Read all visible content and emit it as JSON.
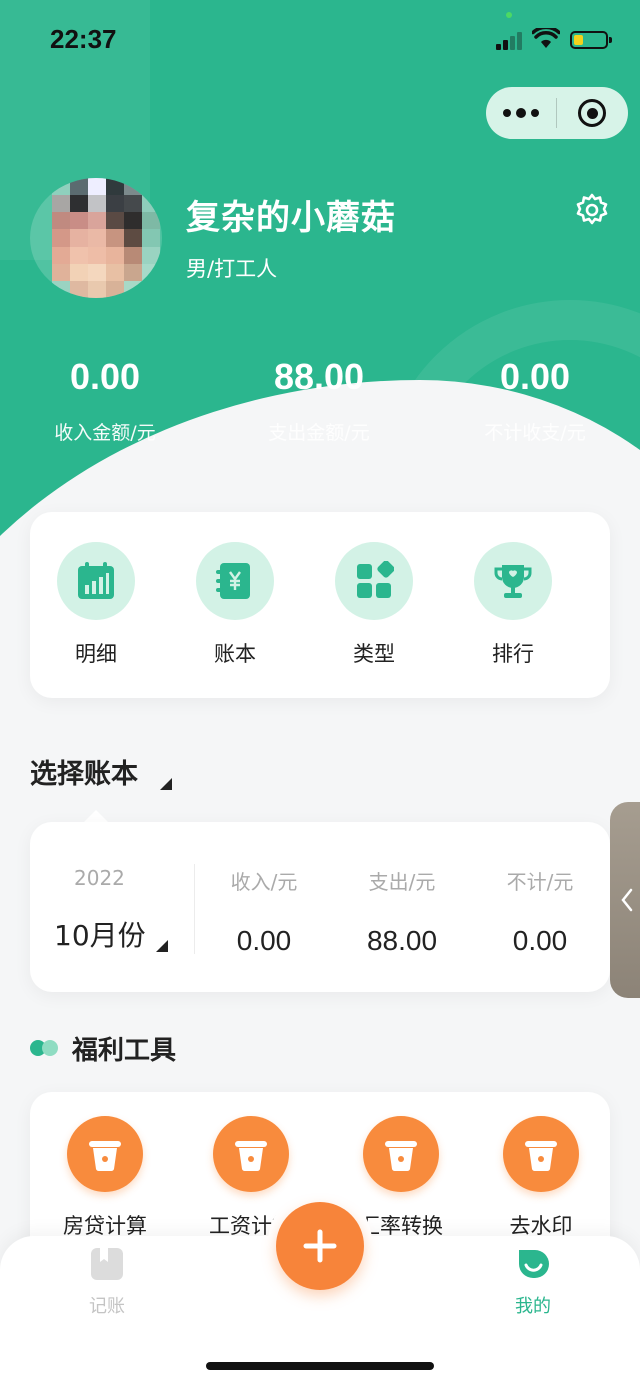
{
  "status_bar": {
    "time": "22:37",
    "battery_level": 0.3
  },
  "capsule": {
    "more_icon": "more-dots-icon",
    "close_icon": "target-circle-icon"
  },
  "profile": {
    "nickname": "复杂的小蘑菇",
    "subtitle": "男/打工人"
  },
  "summary": [
    {
      "value": "0.00",
      "label": "收入金额/元"
    },
    {
      "value": "88.00",
      "label": "支出金额/元"
    },
    {
      "value": "0.00",
      "label": "不计收支/元"
    }
  ],
  "menu": [
    {
      "label": "明细",
      "icon": "calendar-chart-icon"
    },
    {
      "label": "账本",
      "icon": "yen-book-icon"
    },
    {
      "label": "类型",
      "icon": "category-grid-icon"
    },
    {
      "label": "排行",
      "icon": "trophy-icon"
    }
  ],
  "ledger": {
    "title": "选择账本",
    "year": "2022",
    "month": "10月份",
    "columns": [
      {
        "label": "收入/元",
        "value": "0.00"
      },
      {
        "label": "支出/元",
        "value": "88.00"
      },
      {
        "label": "不计/元",
        "value": "0.00"
      }
    ]
  },
  "tools": {
    "title": "福利工具",
    "items": [
      {
        "label": "房贷计算"
      },
      {
        "label": "工资计算"
      },
      {
        "label": "汇率转换"
      },
      {
        "label": "去水印"
      }
    ]
  },
  "tabbar": {
    "items": [
      {
        "label": "记账",
        "icon": "bookmark-icon",
        "active": false
      },
      {
        "label": "我的",
        "icon": "smile-leaf-icon",
        "active": true
      }
    ],
    "fab_icon": "plus-icon"
  },
  "colors": {
    "brand_green": "#2bb68e",
    "accent_orange": "#f7843a",
    "light_green": "#d3f2e6"
  }
}
